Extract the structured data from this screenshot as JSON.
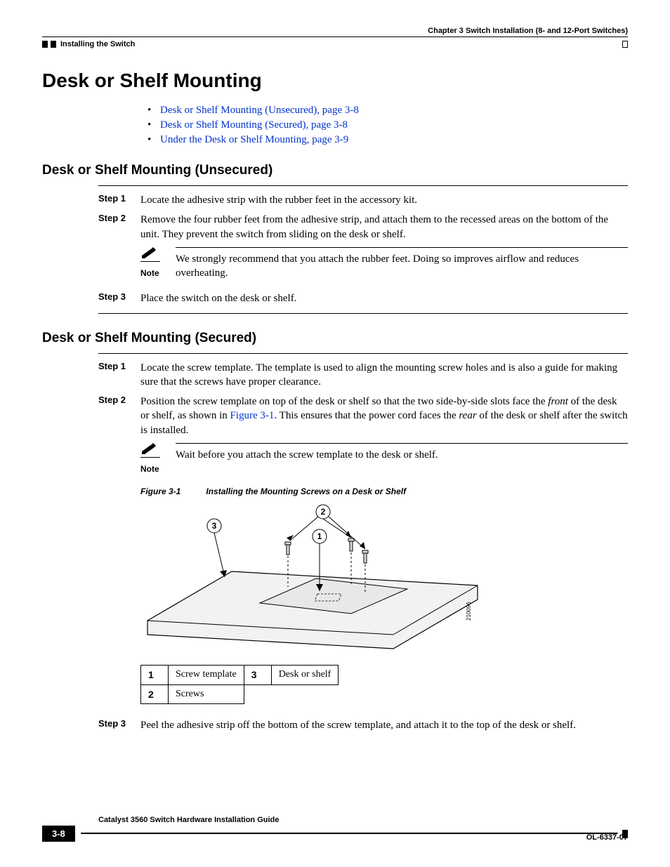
{
  "header": {
    "chapter": "Chapter 3      Switch Installation (8- and 12-Port Switches)",
    "section_running": "Installing the Switch"
  },
  "h1": "Desk or Shelf Mounting",
  "toc": [
    "Desk or Shelf Mounting (Unsecured), page 3-8",
    "Desk or Shelf Mounting (Secured), page 3-8",
    "Under the Desk or Shelf Mounting, page 3-9"
  ],
  "unsecured": {
    "title": "Desk or Shelf Mounting (Unsecured)",
    "step1": {
      "label": "Step 1",
      "text": "Locate the adhesive strip with the rubber feet in the accessory kit."
    },
    "step2": {
      "label": "Step 2",
      "text": "Remove the four rubber feet from the adhesive strip, and attach them to the recessed areas on the bottom of the unit. They prevent the switch from sliding on the desk or shelf."
    },
    "note": {
      "label": "Note",
      "text": "We strongly recommend that you attach the rubber feet. Doing so improves airflow and reduces overheating."
    },
    "step3": {
      "label": "Step 3",
      "text": "Place the switch on the desk or shelf."
    }
  },
  "secured": {
    "title": "Desk or Shelf Mounting (Secured)",
    "step1": {
      "label": "Step 1",
      "text": "Locate the screw template. The template is used to align the mounting screw holes and is also a guide for making sure that the screws have proper clearance."
    },
    "step2": {
      "label": "Step 2",
      "pre": "Position the screw template on top of the desk or shelf so that the two side-by-side slots face the ",
      "front": "front",
      "mid": " of the desk or shelf, as shown in ",
      "figref": "Figure 3-1",
      "post1": ". This ensures that the power cord faces the ",
      "rear": "rear",
      "post2": " of the desk or shelf after the switch is installed."
    },
    "note": {
      "label": "Note",
      "text": "Wait before you attach the screw template to the desk or shelf."
    },
    "figure": {
      "num": "Figure 3-1",
      "title": "Installing the Mounting Screws on a Desk or Shelf",
      "artid": "210096",
      "callout1": "1",
      "callout2": "2",
      "callout3": "3",
      "legend": [
        {
          "k": "1",
          "v": "Screw template"
        },
        {
          "k": "2",
          "v": "Screws"
        },
        {
          "k": "3",
          "v": "Desk or shelf"
        }
      ]
    },
    "step3": {
      "label": "Step 3",
      "text": "Peel the adhesive strip off the bottom of the screw template, and attach it to the top of the desk or shelf."
    }
  },
  "footer": {
    "guide": "Catalyst 3560 Switch Hardware Installation Guide",
    "page": "3-8",
    "docid": "OL-6337-07"
  }
}
